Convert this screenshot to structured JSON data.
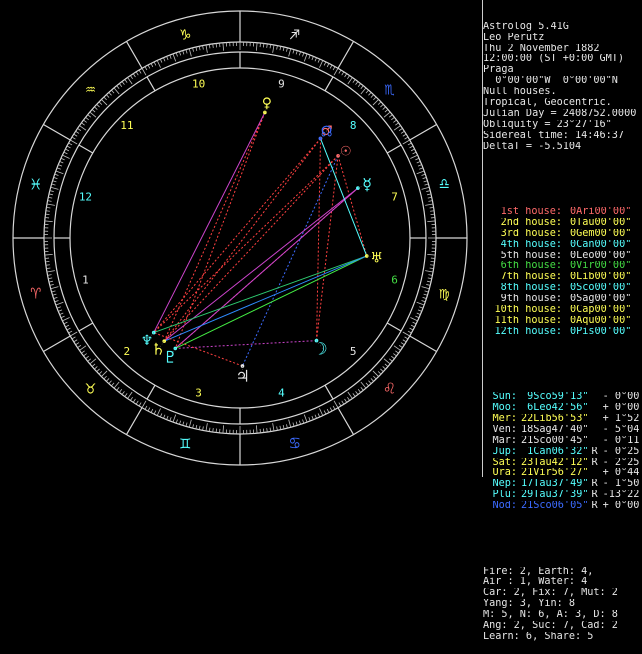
{
  "colors": {
    "background": "#000000",
    "fire": "#ff6a6a",
    "earth": "#ffff55",
    "air": "#55ffff",
    "water": "#3c6bff",
    "plain": "#e6e6e6",
    "houses": "#cfcfcf",
    "green": "#44dd44",
    "dim": "#8c8c8c"
  },
  "header": [
    "Astrolog 5.41G",
    "Leo Perutz",
    "Thu 2 November 1882",
    "12:00:00 (ST +0:00 GMT)",
    "Praga",
    "  0°00'00\"W  0°00'00\"N",
    "Null houses.",
    "Tropical, Geocentric.",
    "Julian Day = 2408752.0000",
    "Obliquity = 23°27'16\"",
    "Sidereal time: 14:46:37",
    "DeltaT = -5.5104"
  ],
  "cusps": [
    {
      "label": "1st house:",
      "value": "0Ari00'00\"",
      "color": "#ff6a6a"
    },
    {
      "label": "2nd house:",
      "value": "0Tau00'00\"",
      "color": "#ffff55"
    },
    {
      "label": "3rd house:",
      "value": "0Gem00'00\"",
      "color": "#ffff55"
    },
    {
      "label": "4th house:",
      "value": "0Can00'00\"",
      "color": "#55ffff"
    },
    {
      "label": "5th house:",
      "value": "0Leo00'00\"",
      "color": "#e6e6e6"
    },
    {
      "label": "6th house:",
      "value": "0Vir00'00\"",
      "color": "#44dd44"
    },
    {
      "label": "7th house:",
      "value": "0Lib00'00\"",
      "color": "#ffff55"
    },
    {
      "label": "8th house:",
      "value": "0Sco00'00\"",
      "color": "#55ffff"
    },
    {
      "label": "9th house:",
      "value": "0Sag00'00\"",
      "color": "#e6e6e6"
    },
    {
      "label": "10th house:",
      "value": "0Cap00'00\"",
      "color": "#ffff55"
    },
    {
      "label": "11th house:",
      "value": "0Aqu00'00\"",
      "color": "#ffff55"
    },
    {
      "label": "12th house:",
      "value": "0Pis00'00\"",
      "color": "#55ffff"
    }
  ],
  "planets": [
    {
      "name": "Sun:",
      "pos": " 9Sco59'13\"",
      "flag": " ",
      "speed": "- 0°00'",
      "color": "#55ffff"
    },
    {
      "name": "Moo:",
      "pos": " 6Leo42'56\"",
      "flag": " ",
      "speed": "+ 0°00'",
      "color": "#55ffff"
    },
    {
      "name": "Mer:",
      "pos": "22Lib56'53\"",
      "flag": " ",
      "speed": "+ 1°52'",
      "color": "#ffff55"
    },
    {
      "name": "Ven:",
      "pos": "18Sag47'40\"",
      "flag": " ",
      "speed": "- 5°04'",
      "color": "#e6e6e6"
    },
    {
      "name": "Mar:",
      "pos": "21Sco00'45\"",
      "flag": " ",
      "speed": "- 0°11'",
      "color": "#e6e6e6"
    },
    {
      "name": "Jup:",
      "pos": " 1Can06'32\"",
      "flag": "R",
      "speed": "- 0°25'",
      "color": "#55ffff"
    },
    {
      "name": "Sat:",
      "pos": "23Tau42'12\"",
      "flag": "R",
      "speed": "- 2°25'",
      "color": "#ffff55"
    },
    {
      "name": "Ura:",
      "pos": "21Vir56'27\"",
      "flag": " ",
      "speed": "+ 0°44'",
      "color": "#ffff55"
    },
    {
      "name": "Nep:",
      "pos": "17Tau37'49\"",
      "flag": "R",
      "speed": "- 1°50'",
      "color": "#55ffff"
    },
    {
      "name": "Plu:",
      "pos": "29Tau37'39\"",
      "flag": "R",
      "speed": "-13°22'",
      "color": "#55ffff"
    },
    {
      "name": "Nod:",
      "pos": "21Sco06'05\"",
      "flag": "R",
      "speed": "+ 0°00'",
      "color": "#3c6bff"
    }
  ],
  "summary": [
    "Fire: 2, Earth: 4,",
    "Air : 1, Water: 4",
    "Car: 2, Fix: 7, Mut: 2",
    "Yang: 3, Yin: 8",
    "M: 5, N: 6, A: 3, D: 8",
    "Ang: 2, Suc: 7, Cad: 2",
    "Learn: 6, Share: 5"
  ],
  "wheel": {
    "signs": [
      {
        "name": "aries-icon",
        "glyph": "♈",
        "color": "#ff6a6a"
      },
      {
        "name": "taurus-icon",
        "glyph": "♉",
        "color": "#ffff55"
      },
      {
        "name": "gemini-icon",
        "glyph": "♊",
        "color": "#55ffff"
      },
      {
        "name": "cancer-icon",
        "glyph": "♋",
        "color": "#3c6bff"
      },
      {
        "name": "leo-icon",
        "glyph": "♌",
        "color": "#ff6a6a"
      },
      {
        "name": "virgo-icon",
        "glyph": "♍",
        "color": "#ffff55"
      },
      {
        "name": "libra-icon",
        "glyph": "♎",
        "color": "#55ffff"
      },
      {
        "name": "scorpio-icon",
        "glyph": "♏",
        "color": "#3c6bff"
      },
      {
        "name": "sagittarius-icon",
        "glyph": "♐",
        "color": "#e6e6e6"
      },
      {
        "name": "capricorn-icon",
        "glyph": "♑",
        "color": "#ffff55"
      },
      {
        "name": "aquarius-icon",
        "glyph": "♒",
        "color": "#ffff55"
      },
      {
        "name": "pisces-icon",
        "glyph": "♓",
        "color": "#55ffff"
      }
    ],
    "house_numbers": [
      {
        "label": "1",
        "color": "#e6e6e6"
      },
      {
        "label": "2",
        "color": "#ffff55"
      },
      {
        "label": "3",
        "color": "#ffff55"
      },
      {
        "label": "4",
        "color": "#55ffff"
      },
      {
        "label": "5",
        "color": "#e6e6e6"
      },
      {
        "label": "6",
        "color": "#44dd44"
      },
      {
        "label": "7",
        "color": "#ffff55"
      },
      {
        "label": "8",
        "color": "#55ffff"
      },
      {
        "label": "9",
        "color": "#e6e6e6"
      },
      {
        "label": "10",
        "color": "#ffff55"
      },
      {
        "label": "11",
        "color": "#ffff55"
      },
      {
        "label": "12",
        "color": "#55ffff"
      }
    ],
    "planet_glyphs": [
      {
        "name": "sun-icon",
        "glyph": "☉",
        "lon": 219.987,
        "color": "#ff6a6a"
      },
      {
        "name": "moon-icon",
        "glyph": "☽",
        "lon": 126.715,
        "color": "#55ffff"
      },
      {
        "name": "mercury-icon",
        "glyph": "☿",
        "lon": 202.948,
        "color": "#55ffff"
      },
      {
        "name": "venus-icon",
        "glyph": "♀",
        "lon": 258.794,
        "color": "#ffff55"
      },
      {
        "name": "mars-icon",
        "glyph": "♂",
        "lon": 231.012,
        "color": "#ff6a6a"
      },
      {
        "name": "jupiter-icon",
        "glyph": "♃",
        "lon": 91.109,
        "color": "#e6e6e6"
      },
      {
        "name": "saturn-icon",
        "glyph": "♄",
        "lon": 53.703,
        "color": "#ffff55"
      },
      {
        "name": "uranus-icon",
        "glyph": "♅",
        "lon": 171.941,
        "color": "#ffff55"
      },
      {
        "name": "neptune-icon",
        "glyph": "♆",
        "lon": 47.63,
        "color": "#55ffff"
      },
      {
        "name": "pluto-icon",
        "glyph": "♇",
        "lon": 59.628,
        "color": "#55ffff"
      },
      {
        "name": "node-icon",
        "glyph": "☊",
        "lon": 231.101,
        "color": "#3c6bff"
      }
    ],
    "aspects": [
      {
        "a": 0,
        "b": 1,
        "color": "#ff4040",
        "dash": "2,2"
      },
      {
        "a": 0,
        "b": 6,
        "color": "#ff4040",
        "dash": "2,2"
      },
      {
        "a": 0,
        "b": 8,
        "color": "#ff4040",
        "dash": "2,2"
      },
      {
        "a": 4,
        "b": 6,
        "color": "#ff4040",
        "dash": "2,2"
      },
      {
        "a": 4,
        "b": 8,
        "color": "#ff4040",
        "dash": "2,2"
      },
      {
        "a": 2,
        "b": 9,
        "color": "#ff4040",
        "dash": "2,2"
      },
      {
        "a": 1,
        "b": 4,
        "color": "#ff4040",
        "dash": "2,2"
      },
      {
        "a": 0,
        "b": 5,
        "color": "#3c6bff",
        "dash": "2,2"
      },
      {
        "a": 0,
        "b": 7,
        "color": "#ff4040",
        "dash": "2,2"
      },
      {
        "a": 3,
        "b": 6,
        "color": "#ff4040",
        "dash": "2,2"
      },
      {
        "a": 3,
        "b": 9,
        "color": "#ff4040",
        "dash": "2,2"
      },
      {
        "a": 3,
        "b": 8,
        "color": "#cc44cc",
        "dash": ""
      },
      {
        "a": 2,
        "b": 6,
        "color": "#cc44cc",
        "dash": ""
      },
      {
        "a": 2,
        "b": 9,
        "color": "#cc44cc",
        "dash": ""
      },
      {
        "a": 7,
        "b": 8,
        "color": "#2ecc71",
        "dash": ""
      },
      {
        "a": 7,
        "b": 9,
        "color": "#44ee44",
        "dash": ""
      },
      {
        "a": 7,
        "b": 6,
        "color": "#2e8bff",
        "dash": ""
      },
      {
        "a": 4,
        "b": 7,
        "color": "#55ffff",
        "dash": ""
      },
      {
        "a": 1,
        "b": 9,
        "color": "#cc44cc",
        "dash": "2,2"
      },
      {
        "a": 5,
        "b": 8,
        "color": "#ff4040",
        "dash": "2,2"
      }
    ]
  }
}
